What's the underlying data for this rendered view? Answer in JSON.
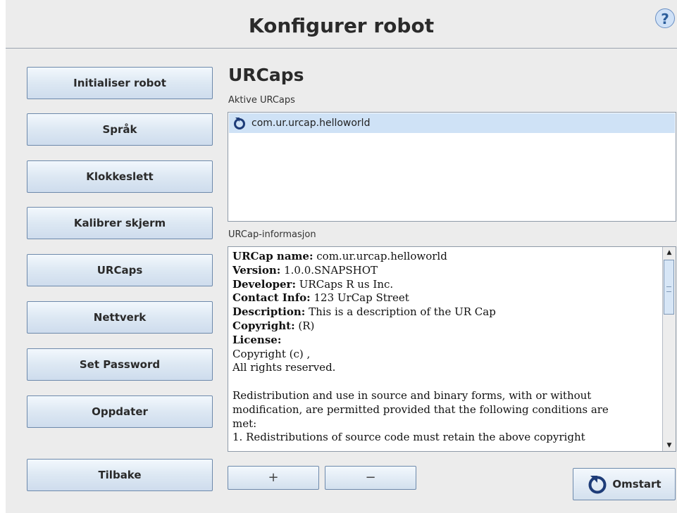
{
  "header": {
    "title": "Konfigurer robot",
    "help_glyph": "?"
  },
  "sidebar": {
    "items": [
      {
        "label": "Initialiser robot"
      },
      {
        "label": "Språk"
      },
      {
        "label": "Klokkeslett"
      },
      {
        "label": "Kalibrer skjerm"
      },
      {
        "label": "URCaps"
      },
      {
        "label": "Nettverk"
      },
      {
        "label": "Set Password"
      },
      {
        "label": "Oppdater"
      }
    ],
    "back_label": "Tilbake"
  },
  "main": {
    "heading": "URCaps",
    "active_label": "Aktive URCaps",
    "active_list": [
      {
        "name": "com.ur.urcap.helloworld",
        "icon": "restart-icon"
      }
    ],
    "info_label": "URCap-informasjon",
    "info": {
      "name_key": "URCap name:",
      "name_val": "com.ur.urcap.helloworld",
      "version_key": "Version:",
      "version_val": "1.0.0.SNAPSHOT",
      "developer_key": "Developer:",
      "developer_val": "URCaps R us Inc.",
      "contact_key": "Contact Info:",
      "contact_val": "123 UrCap Street",
      "description_key": "Description:",
      "description_val": "This is a description of the UR Cap",
      "copyright_key": "Copyright:",
      "copyright_val": "(R)",
      "license_key": "License:",
      "license_line1": "Copyright (c) ,",
      "license_line2": "All rights reserved.",
      "para_line1": "Redistribution and use in source and binary forms, with or without",
      "para_line2": "modification, are permitted provided that the following conditions are",
      "para_line3": "met:",
      "para_line4": "1. Redistributions of source code must retain the above copyright"
    },
    "add_glyph": "+",
    "remove_glyph": "−",
    "restart_label": "Omstart"
  },
  "colors": {
    "accent": "#cfe2f6",
    "button_border": "#6d89ab",
    "background": "#ececec"
  }
}
